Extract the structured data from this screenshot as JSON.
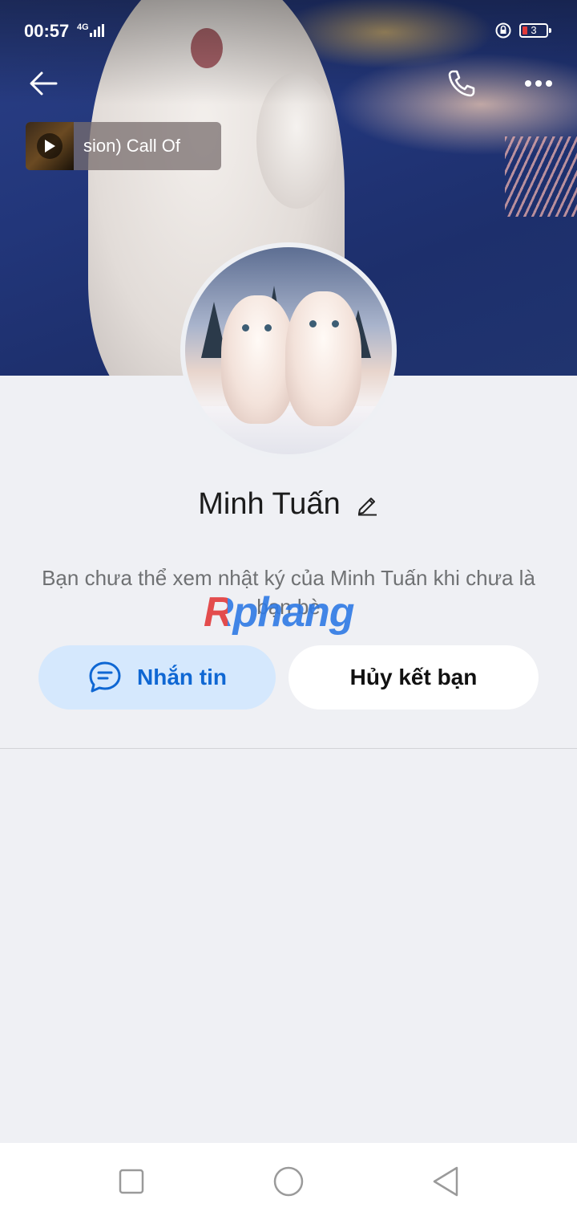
{
  "status_bar": {
    "time": "00:57",
    "network": "4G",
    "battery": "3"
  },
  "music_chip": {
    "text": "sion)          Call Of"
  },
  "profile": {
    "name": "Minh Tuấn"
  },
  "info": {
    "message": "Bạn chưa thể xem nhật ký của Minh Tuấn khi chưa là bạn bè"
  },
  "watermark": "Rphang",
  "actions": {
    "message_label": "Nhắn tin",
    "unfriend_label": "Hủy kết bạn"
  },
  "colors": {
    "accent": "#0f67d3",
    "accent_bg": "#d5e8fd",
    "background": "#eff0f4"
  },
  "icons": {
    "back": "arrow-left-icon",
    "call": "phone-icon",
    "more": "more-dots-icon",
    "edit": "pencil-icon",
    "chat": "chat-bubble-icon"
  }
}
